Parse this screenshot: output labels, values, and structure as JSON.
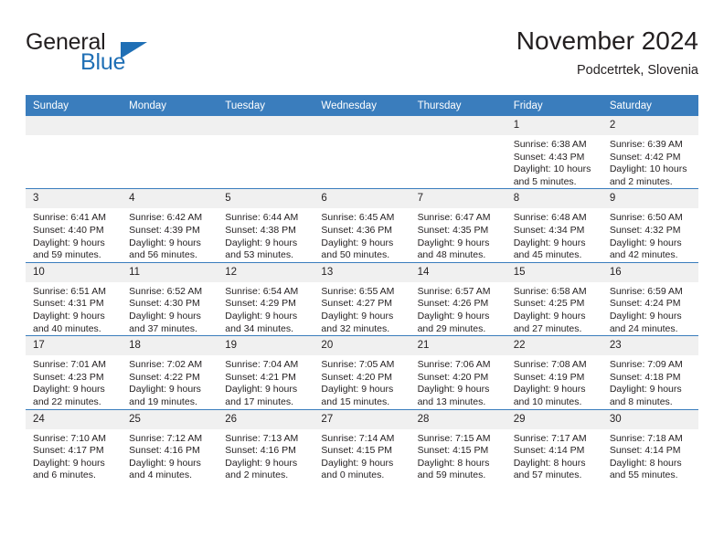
{
  "brand": {
    "name_primary": "General",
    "name_secondary": "Blue",
    "accent_color": "#1f6fb5"
  },
  "header": {
    "title": "November 2024",
    "subtitle": "Podcetrtek, Slovenia"
  },
  "theme": {
    "header_bg": "#3a7dbd",
    "daynum_bg": "#f0f0f0",
    "text": "#231f20"
  },
  "weekday_headers": [
    "Sunday",
    "Monday",
    "Tuesday",
    "Wednesday",
    "Thursday",
    "Friday",
    "Saturday"
  ],
  "weeks": [
    [
      {
        "day": "",
        "lines": []
      },
      {
        "day": "",
        "lines": []
      },
      {
        "day": "",
        "lines": []
      },
      {
        "day": "",
        "lines": []
      },
      {
        "day": "",
        "lines": []
      },
      {
        "day": "1",
        "lines": [
          "Sunrise: 6:38 AM",
          "Sunset: 4:43 PM",
          "Daylight: 10 hours",
          "and 5 minutes."
        ]
      },
      {
        "day": "2",
        "lines": [
          "Sunrise: 6:39 AM",
          "Sunset: 4:42 PM",
          "Daylight: 10 hours",
          "and 2 minutes."
        ]
      }
    ],
    [
      {
        "day": "3",
        "lines": [
          "Sunrise: 6:41 AM",
          "Sunset: 4:40 PM",
          "Daylight: 9 hours",
          "and 59 minutes."
        ]
      },
      {
        "day": "4",
        "lines": [
          "Sunrise: 6:42 AM",
          "Sunset: 4:39 PM",
          "Daylight: 9 hours",
          "and 56 minutes."
        ]
      },
      {
        "day": "5",
        "lines": [
          "Sunrise: 6:44 AM",
          "Sunset: 4:38 PM",
          "Daylight: 9 hours",
          "and 53 minutes."
        ]
      },
      {
        "day": "6",
        "lines": [
          "Sunrise: 6:45 AM",
          "Sunset: 4:36 PM",
          "Daylight: 9 hours",
          "and 50 minutes."
        ]
      },
      {
        "day": "7",
        "lines": [
          "Sunrise: 6:47 AM",
          "Sunset: 4:35 PM",
          "Daylight: 9 hours",
          "and 48 minutes."
        ]
      },
      {
        "day": "8",
        "lines": [
          "Sunrise: 6:48 AM",
          "Sunset: 4:34 PM",
          "Daylight: 9 hours",
          "and 45 minutes."
        ]
      },
      {
        "day": "9",
        "lines": [
          "Sunrise: 6:50 AM",
          "Sunset: 4:32 PM",
          "Daylight: 9 hours",
          "and 42 minutes."
        ]
      }
    ],
    [
      {
        "day": "10",
        "lines": [
          "Sunrise: 6:51 AM",
          "Sunset: 4:31 PM",
          "Daylight: 9 hours",
          "and 40 minutes."
        ]
      },
      {
        "day": "11",
        "lines": [
          "Sunrise: 6:52 AM",
          "Sunset: 4:30 PM",
          "Daylight: 9 hours",
          "and 37 minutes."
        ]
      },
      {
        "day": "12",
        "lines": [
          "Sunrise: 6:54 AM",
          "Sunset: 4:29 PM",
          "Daylight: 9 hours",
          "and 34 minutes."
        ]
      },
      {
        "day": "13",
        "lines": [
          "Sunrise: 6:55 AM",
          "Sunset: 4:27 PM",
          "Daylight: 9 hours",
          "and 32 minutes."
        ]
      },
      {
        "day": "14",
        "lines": [
          "Sunrise: 6:57 AM",
          "Sunset: 4:26 PM",
          "Daylight: 9 hours",
          "and 29 minutes."
        ]
      },
      {
        "day": "15",
        "lines": [
          "Sunrise: 6:58 AM",
          "Sunset: 4:25 PM",
          "Daylight: 9 hours",
          "and 27 minutes."
        ]
      },
      {
        "day": "16",
        "lines": [
          "Sunrise: 6:59 AM",
          "Sunset: 4:24 PM",
          "Daylight: 9 hours",
          "and 24 minutes."
        ]
      }
    ],
    [
      {
        "day": "17",
        "lines": [
          "Sunrise: 7:01 AM",
          "Sunset: 4:23 PM",
          "Daylight: 9 hours",
          "and 22 minutes."
        ]
      },
      {
        "day": "18",
        "lines": [
          "Sunrise: 7:02 AM",
          "Sunset: 4:22 PM",
          "Daylight: 9 hours",
          "and 19 minutes."
        ]
      },
      {
        "day": "19",
        "lines": [
          "Sunrise: 7:04 AM",
          "Sunset: 4:21 PM",
          "Daylight: 9 hours",
          "and 17 minutes."
        ]
      },
      {
        "day": "20",
        "lines": [
          "Sunrise: 7:05 AM",
          "Sunset: 4:20 PM",
          "Daylight: 9 hours",
          "and 15 minutes."
        ]
      },
      {
        "day": "21",
        "lines": [
          "Sunrise: 7:06 AM",
          "Sunset: 4:20 PM",
          "Daylight: 9 hours",
          "and 13 minutes."
        ]
      },
      {
        "day": "22",
        "lines": [
          "Sunrise: 7:08 AM",
          "Sunset: 4:19 PM",
          "Daylight: 9 hours",
          "and 10 minutes."
        ]
      },
      {
        "day": "23",
        "lines": [
          "Sunrise: 7:09 AM",
          "Sunset: 4:18 PM",
          "Daylight: 9 hours",
          "and 8 minutes."
        ]
      }
    ],
    [
      {
        "day": "24",
        "lines": [
          "Sunrise: 7:10 AM",
          "Sunset: 4:17 PM",
          "Daylight: 9 hours",
          "and 6 minutes."
        ]
      },
      {
        "day": "25",
        "lines": [
          "Sunrise: 7:12 AM",
          "Sunset: 4:16 PM",
          "Daylight: 9 hours",
          "and 4 minutes."
        ]
      },
      {
        "day": "26",
        "lines": [
          "Sunrise: 7:13 AM",
          "Sunset: 4:16 PM",
          "Daylight: 9 hours",
          "and 2 minutes."
        ]
      },
      {
        "day": "27",
        "lines": [
          "Sunrise: 7:14 AM",
          "Sunset: 4:15 PM",
          "Daylight: 9 hours",
          "and 0 minutes."
        ]
      },
      {
        "day": "28",
        "lines": [
          "Sunrise: 7:15 AM",
          "Sunset: 4:15 PM",
          "Daylight: 8 hours",
          "and 59 minutes."
        ]
      },
      {
        "day": "29",
        "lines": [
          "Sunrise: 7:17 AM",
          "Sunset: 4:14 PM",
          "Daylight: 8 hours",
          "and 57 minutes."
        ]
      },
      {
        "day": "30",
        "lines": [
          "Sunrise: 7:18 AM",
          "Sunset: 4:14 PM",
          "Daylight: 8 hours",
          "and 55 minutes."
        ]
      }
    ]
  ]
}
